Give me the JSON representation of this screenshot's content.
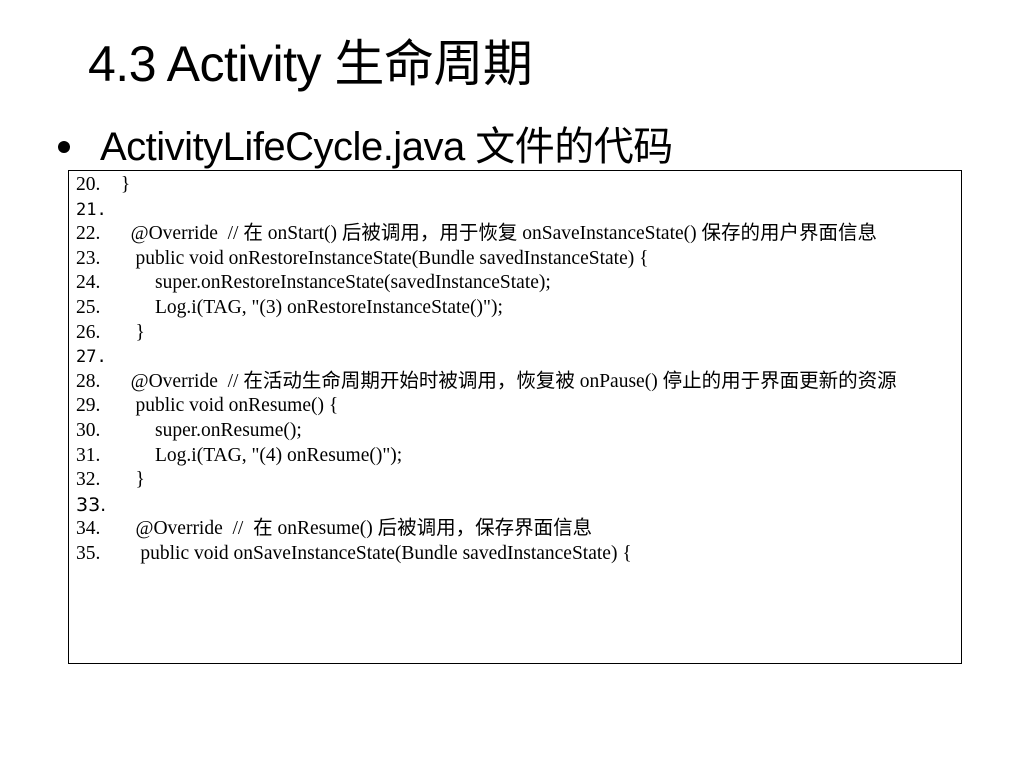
{
  "slide": {
    "title": "4.3 Activity 生命周期",
    "bullet": "ActivityLifeCycle.java 文件的代码"
  },
  "code": {
    "lines": [
      {
        "num": "20.",
        "text": " }"
      },
      {
        "num": "21.",
        "text": ""
      },
      {
        "num": "22.",
        "text": "   @Override  // 在 onStart() 后被调用，用于恢复 onSaveInstanceState() 保存的用户界面信息"
      },
      {
        "num": "23.",
        "text": "    public void onRestoreInstanceState(Bundle savedInstanceState) {"
      },
      {
        "num": "24.",
        "text": "        super.onRestoreInstanceState(savedInstanceState);"
      },
      {
        "num": "25.",
        "text": "        Log.i(TAG, \"(3) onRestoreInstanceState()\");"
      },
      {
        "num": "26.",
        "text": "    }"
      },
      {
        "num": "27.",
        "text": ""
      },
      {
        "num": "28.",
        "text": "   @Override  // 在活动生命周期开始时被调用，恢复被 onPause() 停止的用于界面更新的资源"
      },
      {
        "num": "29.",
        "text": "    public void onResume() {"
      },
      {
        "num": "30.",
        "text": "        super.onResume();"
      },
      {
        "num": "31.",
        "text": "        Log.i(TAG, \"(4) onResume()\");"
      },
      {
        "num": "32.",
        "text": "    }"
      },
      {
        "num": "33.",
        "text": ""
      },
      {
        "num": "34.",
        "text": "    @Override  //  在 onResume() 后被调用，保存界面信息"
      },
      {
        "num": "35.",
        "text": "     public void onSaveInstanceState(Bundle savedInstanceState) {"
      }
    ]
  }
}
